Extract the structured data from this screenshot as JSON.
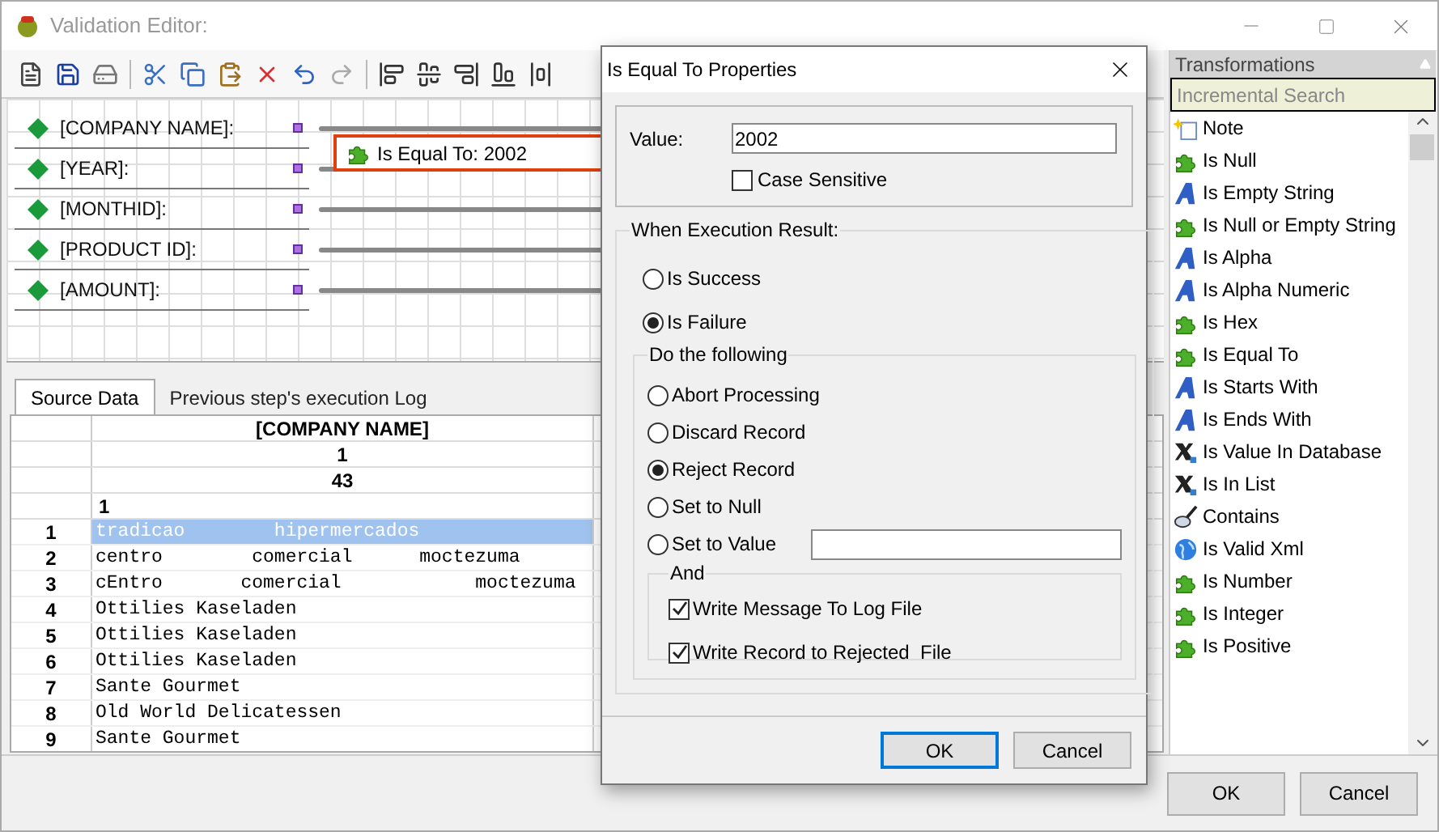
{
  "window": {
    "title": "Validation Editor:"
  },
  "canvas": {
    "fields": [
      {
        "label": "[COMPANY NAME]:"
      },
      {
        "label": "[YEAR]:"
      },
      {
        "label": "[MONTHID]:"
      },
      {
        "label": "[PRODUCT ID]:"
      },
      {
        "label": "[AMOUNT]:"
      }
    ],
    "node": {
      "label": "Is Equal To: 2002"
    }
  },
  "tabs": [
    {
      "label": "Source Data",
      "selected": true
    },
    {
      "label": "Previous step's execution Log",
      "selected": false
    }
  ],
  "grid": {
    "header_rows": [
      {
        "text": "[COMPANY NAME]",
        "kind": "centered"
      },
      {
        "text": "1",
        "kind": "centered"
      },
      {
        "text": "43",
        "kind": "centered"
      },
      {
        "text": "1",
        "kind": "left"
      }
    ],
    "rows": [
      {
        "number": "1",
        "text": "tradicao        hipermercados",
        "selected": true
      },
      {
        "number": "2",
        "text": "centro        comercial      moctezuma",
        "selected": false
      },
      {
        "number": "3",
        "text": "cEntro       comercial            moctezuma",
        "selected": false
      },
      {
        "number": "4",
        "text": "Ottilies Kaseladen",
        "selected": false
      },
      {
        "number": "5",
        "text": "Ottilies Kaseladen",
        "selected": false
      },
      {
        "number": "6",
        "text": "Ottilies Kaseladen",
        "selected": false
      },
      {
        "number": "7",
        "text": "Sante Gourmet",
        "selected": false
      },
      {
        "number": "8",
        "text": "Old World Delicatessen",
        "selected": false
      },
      {
        "number": "9",
        "text": "Sante Gourmet",
        "selected": false
      }
    ]
  },
  "transformations": {
    "title": "Transformations",
    "search": {
      "placeholder": "Incremental Search"
    },
    "items": [
      {
        "label": "Note",
        "kind": "note"
      },
      {
        "label": "Is Null",
        "kind": "puzzle"
      },
      {
        "label": "Is Empty String",
        "kind": "letter"
      },
      {
        "label": "Is Null or Empty String",
        "kind": "puzzle"
      },
      {
        "label": "Is Alpha",
        "kind": "letter"
      },
      {
        "label": "Is Alpha Numeric",
        "kind": "letter"
      },
      {
        "label": "Is Hex",
        "kind": "puzzle"
      },
      {
        "label": "Is Equal To",
        "kind": "puzzle"
      },
      {
        "label": "Is Starts With",
        "kind": "letter"
      },
      {
        "label": "Is Ends With",
        "kind": "letter"
      },
      {
        "label": "Is Value In Database",
        "kind": "database"
      },
      {
        "label": "Is In List",
        "kind": "database"
      },
      {
        "label": "Contains",
        "kind": "search"
      },
      {
        "label": "Is Valid Xml",
        "kind": "globe"
      },
      {
        "label": "Is Number",
        "kind": "puzzle"
      },
      {
        "label": "Is Integer",
        "kind": "puzzle"
      },
      {
        "label": "Is Positive",
        "kind": "puzzle"
      }
    ]
  },
  "dialog": {
    "title": "Is Equal To Properties",
    "value_label": "Value:",
    "value": "2002",
    "case_sensitive": {
      "label": "Case Sensitive",
      "checked": false
    },
    "result_group": "When Execution Result:",
    "results": [
      {
        "label": "Is Success",
        "selected": false
      },
      {
        "label": "Is Failure",
        "selected": true
      }
    ],
    "action_group": "Do the following",
    "actions": [
      {
        "label": "Abort Processing",
        "selected": false,
        "kind": "plain"
      },
      {
        "label": "Discard Record",
        "selected": false,
        "kind": "plain"
      },
      {
        "label": "Reject Record",
        "selected": true,
        "kind": "plain"
      },
      {
        "label": "Set to Null",
        "selected": false,
        "kind": "plain"
      },
      {
        "label": "Set to Value",
        "selected": false,
        "kind": "value"
      }
    ],
    "and_group": "And",
    "options": [
      {
        "label": "Write Message To Log File",
        "checked": true
      },
      {
        "label": "Write Record to Rejected  File",
        "checked": true
      }
    ],
    "buttons": [
      {
        "label": "OK",
        "kind": "default"
      },
      {
        "label": "Cancel",
        "kind": "normal"
      }
    ]
  },
  "footer_buttons": [
    {
      "label": "OK"
    },
    {
      "label": "Cancel"
    }
  ]
}
